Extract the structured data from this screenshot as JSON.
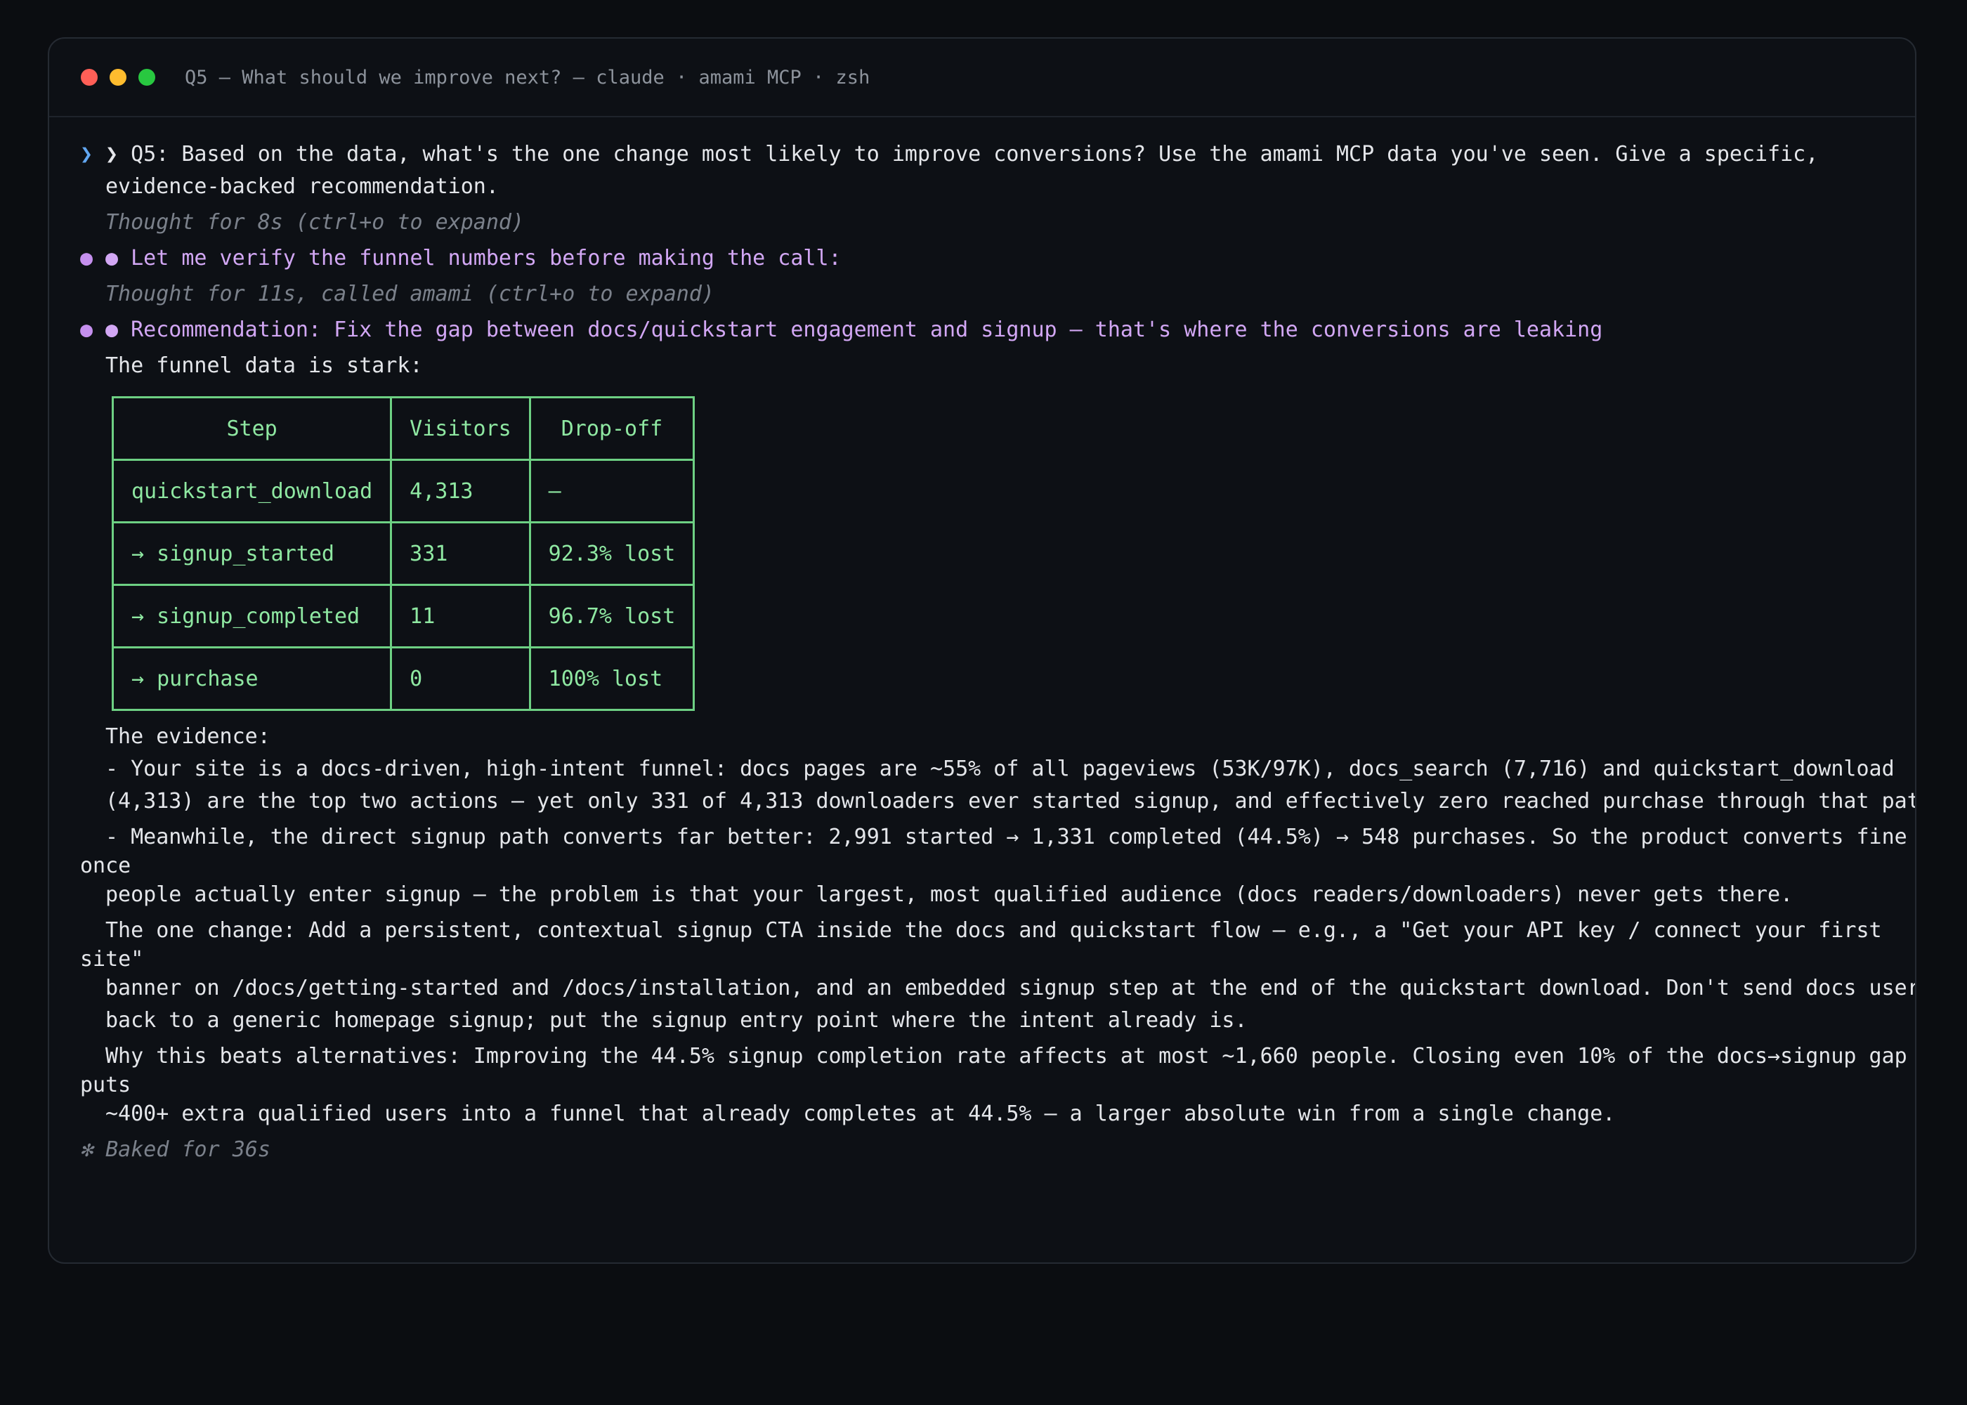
{
  "window": {
    "title": "Q5 — What should we improve next? — claude · amami MCP · zsh",
    "controls": {
      "close_color": "#ff5f57",
      "minimize_color": "#febc2e",
      "maximize_color": "#28c840"
    }
  },
  "conversation": {
    "prompt_marker": "❯",
    "bullet_marker": "●",
    "prompt_line1": "❯ Q5: Based on the data, what's the one change most likely to improve conversions? Use the amami MCP data you've seen. Give a specific,",
    "prompt_line2": "evidence-backed recommendation.",
    "thought1": "Thought for 8s (ctrl+o to expand)",
    "message1": "● Let me verify the funnel numbers before making the call:",
    "thought2": "Thought for 11s, called amami (ctrl+o to expand)",
    "recommendation": "● Recommendation: Fix the gap between docs/quickstart engagement and signup — that's where the conversions are leaking",
    "funnel_intro": "The funnel data is stark:",
    "funnel_table": {
      "headers": [
        "Step",
        "Visitors",
        "Drop-off"
      ],
      "rows": [
        [
          "quickstart_download",
          "4,313",
          "—"
        ],
        [
          "→ signup_started",
          "331",
          "92.3% lost"
        ],
        [
          "→ signup_completed",
          "11",
          "96.7% lost"
        ],
        [
          "→ purchase",
          "0",
          "100% lost"
        ]
      ]
    },
    "evidence_heading": "The evidence:",
    "evidence_lines": [
      "- Your site is a docs-driven, high-intent funnel: docs pages are ~55% of all pageviews (53K/97K), docs_search (7,716) and quickstart_download",
      "(4,313) are the top two actions — yet only 331 of 4,313 downloaders ever started signup, and effectively zero reached purchase through that path.",
      "- Meanwhile, the direct signup path converts far better: 2,991 started → 1,331 completed (44.5%) → 548 purchases. So the product converts fine",
      "once",
      "people actually enter signup — the problem is that your largest, most qualified audience (docs readers/downloaders) never gets there."
    ],
    "one_change_lines": [
      "The one change: Add a persistent, contextual signup CTA inside the docs and quickstart flow — e.g., a \"Get your API key / connect your first",
      "site\"",
      "banner on /docs/getting-started and /docs/installation, and an embedded signup step at the end of the quickstart download. Don't send docs users",
      "back to a generic homepage signup; put the signup entry point where the intent already is."
    ],
    "why_lines": [
      "Why this beats alternatives: Improving the 44.5% signup completion rate affects at most ~1,660 people. Closing even 10% of the docs→signup gap",
      "puts",
      "~400+ extra qualified users into a funnel that already completes at 44.5% — a larger absolute win from a single change."
    ],
    "status": "✻ Baked for 36s"
  },
  "colors": {
    "background": "#0b0d11",
    "window_bg": "#0d1015",
    "text": "#e4e6ea",
    "muted": "#7b818b",
    "accent_lavender": "#d2a7f4",
    "prompt_blue": "#62a7f1",
    "table_green": "#8fe8a2"
  }
}
